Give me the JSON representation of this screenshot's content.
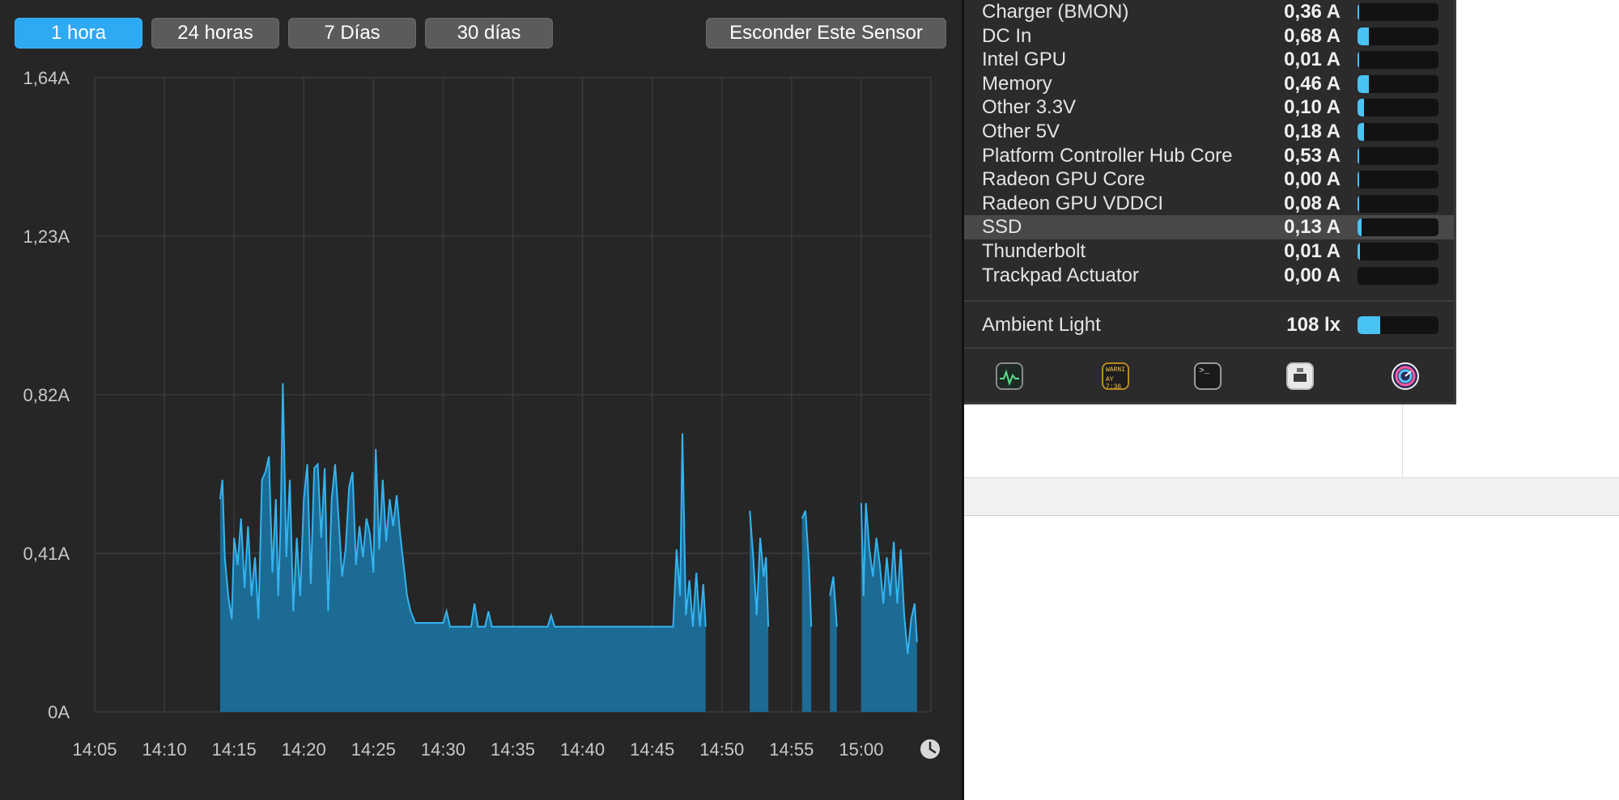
{
  "range_buttons": [
    {
      "label": "1 hora",
      "active": true
    },
    {
      "label": "24 horas",
      "active": false
    },
    {
      "label": "7 Días",
      "active": false
    },
    {
      "label": "30 días",
      "active": false
    }
  ],
  "hide_sensor_label": "Esconder Este Sensor",
  "colors": {
    "accent": "#2ea9f4",
    "line": "#35b3ef",
    "fill": "#1b6b95",
    "panel_bg": "#262626",
    "bar_fill": "#49c3f4"
  },
  "chart_data": {
    "type": "area",
    "unit": "A",
    "y_ticks": [
      "1,64A",
      "1,23A",
      "0,82A",
      "0,41A",
      "0A"
    ],
    "x_ticks": [
      "14:05",
      "14:10",
      "14:15",
      "14:20",
      "14:25",
      "14:30",
      "14:35",
      "14:40",
      "14:45",
      "14:50",
      "14:55",
      "15:00"
    ],
    "ylim": [
      0,
      1.64
    ],
    "grid": true,
    "segments": [
      [
        [
          "14:14:00",
          0.55
        ],
        [
          "14:14:10",
          0.6
        ],
        [
          "14:14:20",
          0.4
        ],
        [
          "14:14:35",
          0.3
        ],
        [
          "14:14:50",
          0.24
        ],
        [
          "14:15:00",
          0.45
        ],
        [
          "14:15:15",
          0.38
        ],
        [
          "14:15:30",
          0.5
        ],
        [
          "14:15:45",
          0.32
        ],
        [
          "14:16:00",
          0.48
        ],
        [
          "14:16:15",
          0.3
        ],
        [
          "14:16:30",
          0.4
        ],
        [
          "14:16:45",
          0.24
        ],
        [
          "14:17:00",
          0.6
        ],
        [
          "14:17:15",
          0.62
        ],
        [
          "14:17:30",
          0.66
        ],
        [
          "14:17:45",
          0.36
        ],
        [
          "14:18:00",
          0.55
        ],
        [
          "14:18:10",
          0.3
        ],
        [
          "14:18:20",
          0.48
        ],
        [
          "14:18:30",
          0.85
        ],
        [
          "14:18:45",
          0.4
        ],
        [
          "14:19:00",
          0.6
        ],
        [
          "14:19:15",
          0.26
        ],
        [
          "14:19:30",
          0.45
        ],
        [
          "14:19:45",
          0.3
        ],
        [
          "14:20:00",
          0.55
        ],
        [
          "14:20:15",
          0.64
        ],
        [
          "14:20:30",
          0.33
        ],
        [
          "14:20:45",
          0.63
        ],
        [
          "14:21:00",
          0.64
        ],
        [
          "14:21:15",
          0.45
        ],
        [
          "14:21:30",
          0.63
        ],
        [
          "14:21:45",
          0.26
        ],
        [
          "14:22:00",
          0.55
        ],
        [
          "14:22:15",
          0.64
        ],
        [
          "14:22:30",
          0.5
        ],
        [
          "14:22:45",
          0.35
        ],
        [
          "14:23:00",
          0.42
        ],
        [
          "14:23:15",
          0.58
        ],
        [
          "14:23:30",
          0.62
        ],
        [
          "14:23:45",
          0.38
        ],
        [
          "14:24:00",
          0.48
        ],
        [
          "14:24:15",
          0.4
        ],
        [
          "14:24:30",
          0.5
        ],
        [
          "14:24:45",
          0.46
        ],
        [
          "14:25:00",
          0.36
        ],
        [
          "14:25:10",
          0.68
        ],
        [
          "14:25:25",
          0.42
        ],
        [
          "14:25:40",
          0.6
        ],
        [
          "14:25:55",
          0.44
        ],
        [
          "14:26:10",
          0.55
        ],
        [
          "14:26:25",
          0.48
        ],
        [
          "14:26:40",
          0.56
        ],
        [
          "14:26:55",
          0.46
        ],
        [
          "14:27:10",
          0.38
        ],
        [
          "14:27:25",
          0.3
        ],
        [
          "14:27:40",
          0.26
        ],
        [
          "14:28:00",
          0.23
        ],
        [
          "14:30:00",
          0.23
        ],
        [
          "14:30:15",
          0.26
        ],
        [
          "14:30:30",
          0.22
        ],
        [
          "14:32:00",
          0.22
        ],
        [
          "14:32:15",
          0.28
        ],
        [
          "14:32:30",
          0.22
        ],
        [
          "14:33:00",
          0.22
        ],
        [
          "14:33:15",
          0.26
        ],
        [
          "14:33:30",
          0.22
        ],
        [
          "14:37:30",
          0.22
        ],
        [
          "14:37:45",
          0.25
        ],
        [
          "14:38:00",
          0.22
        ],
        [
          "14:46:30",
          0.22
        ],
        [
          "14:46:45",
          0.42
        ],
        [
          "14:47:00",
          0.3
        ],
        [
          "14:47:10",
          0.72
        ],
        [
          "14:47:25",
          0.25
        ],
        [
          "14:47:40",
          0.34
        ],
        [
          "14:47:55",
          0.22
        ],
        [
          "14:48:10",
          0.36
        ],
        [
          "14:48:25",
          0.22
        ],
        [
          "14:48:40",
          0.33
        ],
        [
          "14:48:50",
          0.22
        ]
      ],
      [
        [
          "14:52:00",
          0.52
        ],
        [
          "14:52:15",
          0.4
        ],
        [
          "14:52:30",
          0.25
        ],
        [
          "14:52:45",
          0.45
        ],
        [
          "14:53:00",
          0.35
        ],
        [
          "14:53:10",
          0.4
        ],
        [
          "14:53:20",
          0.22
        ]
      ],
      [
        [
          "14:55:45",
          0.5
        ],
        [
          "14:56:00",
          0.52
        ],
        [
          "14:56:15",
          0.38
        ],
        [
          "14:56:25",
          0.22
        ]
      ],
      [
        [
          "14:57:45",
          0.3
        ],
        [
          "14:58:00",
          0.35
        ],
        [
          "14:58:15",
          0.22
        ]
      ],
      [
        [
          "15:00:00",
          0.54
        ],
        [
          "15:00:10",
          0.3
        ],
        [
          "15:00:20",
          0.54
        ],
        [
          "15:00:35",
          0.42
        ],
        [
          "15:00:50",
          0.35
        ],
        [
          "15:01:05",
          0.45
        ],
        [
          "15:01:20",
          0.38
        ],
        [
          "15:01:35",
          0.28
        ],
        [
          "15:01:50",
          0.4
        ],
        [
          "15:02:05",
          0.3
        ],
        [
          "15:02:20",
          0.44
        ],
        [
          "15:02:35",
          0.28
        ],
        [
          "15:02:50",
          0.42
        ],
        [
          "15:03:05",
          0.25
        ],
        [
          "15:03:20",
          0.15
        ],
        [
          "15:03:35",
          0.24
        ],
        [
          "15:03:50",
          0.28
        ],
        [
          "15:04:00",
          0.18
        ]
      ]
    ]
  },
  "sensors": [
    {
      "name": "Charger (BMON)",
      "value": "0,36 A",
      "level": 0.02
    },
    {
      "name": "DC In",
      "value": "0,68 A",
      "level": 0.14
    },
    {
      "name": "Intel GPU",
      "value": "0,01 A",
      "level": 0.01
    },
    {
      "name": "Memory",
      "value": "0,46 A",
      "level": 0.14
    },
    {
      "name": "Other 3.3V",
      "value": "0,10 A",
      "level": 0.08
    },
    {
      "name": "Other 5V",
      "value": "0,18 A",
      "level": 0.08
    },
    {
      "name": "Platform Controller Hub Core",
      "value": "0,53 A",
      "level": 0.02
    },
    {
      "name": "Radeon GPU Core",
      "value": "0,00 A",
      "level": 0.01
    },
    {
      "name": "Radeon GPU VDDCI",
      "value": "0,08 A",
      "level": 0.02
    },
    {
      "name": "SSD",
      "value": "0,13 A",
      "level": 0.05,
      "highlight": true
    },
    {
      "name": "Thunderbolt",
      "value": "0,01 A",
      "level": 0.03
    },
    {
      "name": "Trackpad Actuator",
      "value": "0,00 A",
      "level": 0.0
    }
  ],
  "ambient": {
    "name": "Ambient Light",
    "value": "108 lx",
    "level": 0.28
  },
  "dock_icons": [
    {
      "name": "activity-monitor-icon"
    },
    {
      "name": "console-icon",
      "text_line1": "WARNI",
      "text_line2": "AY 7:36"
    },
    {
      "name": "terminal-icon",
      "text": ">_"
    },
    {
      "name": "system-information-icon"
    },
    {
      "name": "istat-menus-icon"
    }
  ]
}
